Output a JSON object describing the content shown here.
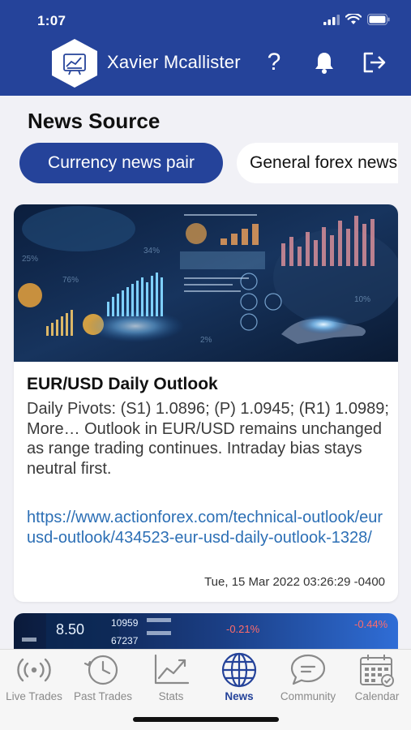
{
  "status_bar": {
    "time": "1:07"
  },
  "header": {
    "user_name": "Xavier Mcallister"
  },
  "page": {
    "title": "News Source"
  },
  "tabs": [
    {
      "label": "Currency news pair",
      "active": true
    },
    {
      "label": "General forex news",
      "active": false
    }
  ],
  "news": [
    {
      "title": "EUR/USD Daily Outlook",
      "description": "Daily Pivots: (S1) 1.0896; (P) 1.0945; (R1) 1.0989; More… Outlook in EUR/USD remains unchanged as range trading continues. Intraday bias stays neutral first.",
      "link": "https://www.actionforex.com/technical-outlook/eurusd-outlook/434523-eur-usd-daily-outlook-1328/",
      "date": "Tue, 15 Mar 2022 03:26:29 -0400"
    }
  ],
  "next_card_image_text": {
    "values": [
      "8.50",
      "10959",
      "67237",
      "-0.21%",
      "-0.44%"
    ]
  },
  "bottom_nav": [
    {
      "label": "Live Trades",
      "icon": "live-trades-icon"
    },
    {
      "label": "Past Trades",
      "icon": "past-trades-icon"
    },
    {
      "label": "Stats",
      "icon": "stats-icon"
    },
    {
      "label": "News",
      "icon": "news-globe-icon",
      "active": true
    },
    {
      "label": "Community",
      "icon": "community-chat-icon"
    },
    {
      "label": "Calendar",
      "icon": "calendar-icon"
    }
  ],
  "colors": {
    "brand": "#25439a",
    "link": "#2c6fb5",
    "background": "#f1f1f6"
  }
}
